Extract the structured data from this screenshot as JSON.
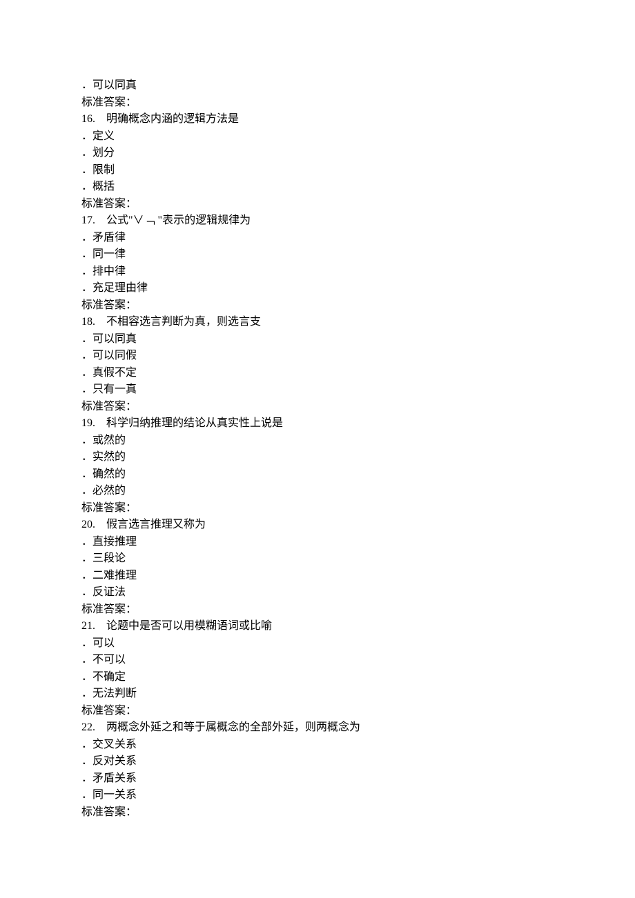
{
  "lines": [
    "．可以同真",
    "标准答案：",
    "16.    明确概念内涵的逻辑方法是",
    "．定义",
    "．划分",
    "．限制",
    "．概括",
    "标准答案：",
    "17.    公式\"∨﹁ \"表示的逻辑规律为",
    "．矛盾律",
    "．同一律",
    "．排中律",
    "．充足理由律",
    "标准答案：",
    "18.    不相容选言判断为真，则选言支",
    "．可以同真",
    "．可以同假",
    "．真假不定",
    "．只有一真",
    "标准答案：",
    "19.    科学归纳推理的结论从真实性上说是",
    "．或然的",
    "．实然的",
    "．确然的",
    "．必然的",
    "标准答案：",
    "20.    假言选言推理又称为",
    "．直接推理",
    "．三段论",
    "．二难推理",
    "．反证法",
    "标准答案：",
    "21.    论题中是否可以用模糊语词或比喻",
    "．可以",
    "．不可以",
    "．不确定",
    "．无法判断",
    "标准答案：",
    "22.    两概念外延之和等于属概念的全部外延，则两概念为",
    "．交叉关系",
    "．反对关系",
    "．矛盾关系",
    "．同一关系",
    "标准答案："
  ]
}
